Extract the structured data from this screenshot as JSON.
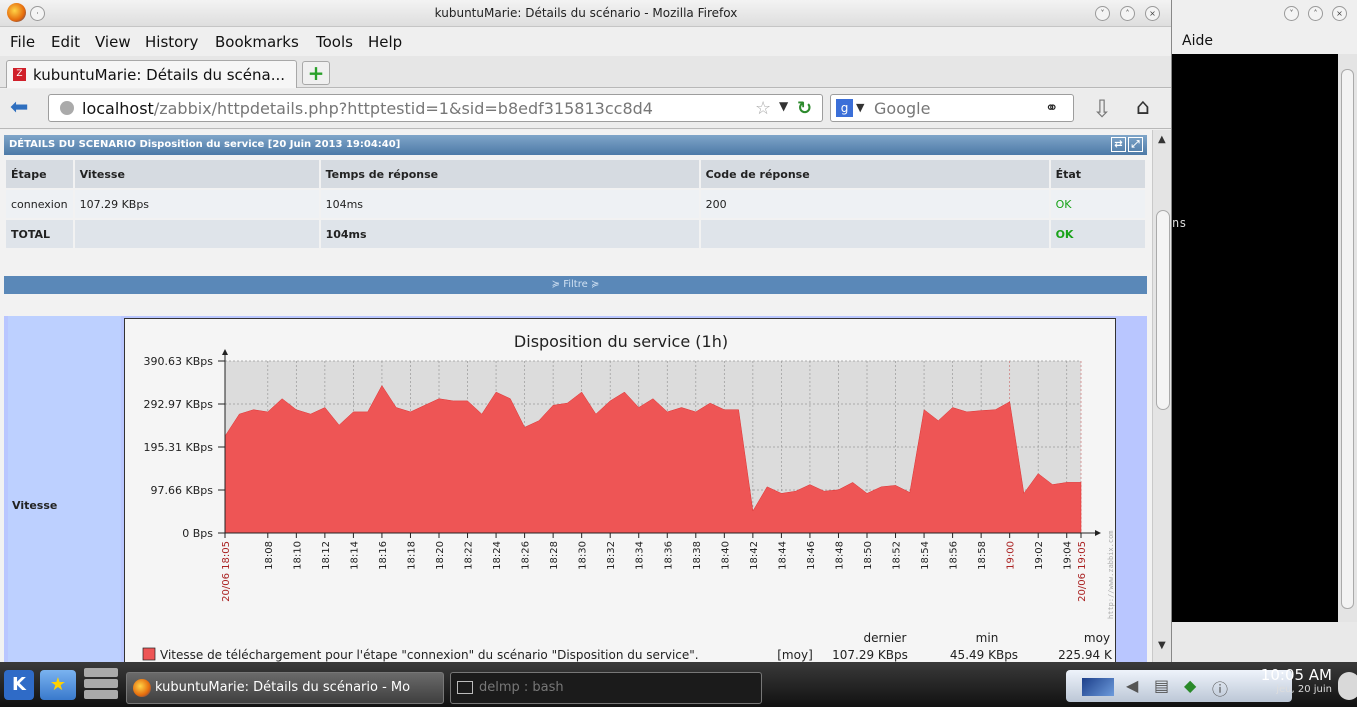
{
  "window": {
    "title": "kubuntuMarie: Détails du scénario - Mozilla Firefox"
  },
  "menu": [
    "File",
    "Edit",
    "View",
    "History",
    "Bookmarks",
    "Tools",
    "Help"
  ],
  "tab": {
    "label": "kubuntuMarie: Détails du scéna...",
    "new_tab": "+"
  },
  "nav": {
    "url_host": "localhost",
    "url_path": "/zabbix/httpdetails.php?httptestid=1&sid=b8edf315813cc8d4",
    "search_engine": "Google"
  },
  "scenario": {
    "header": "DÉTAILS DU SCENARIO Disposition du service [20 Juin 2013 19:04:40]",
    "columns": [
      "Étape",
      "Vitesse",
      "Temps de réponse",
      "Code de réponse",
      "État"
    ],
    "rows": [
      [
        "connexion",
        "107.29 KBps",
        "104ms",
        "200",
        "OK"
      ],
      [
        "TOTAL",
        "",
        "104ms",
        "",
        "OK"
      ]
    ],
    "filter_label": "≽ Filtre ≽"
  },
  "graph_section": {
    "label": "Vitesse"
  },
  "chart_data": {
    "type": "area",
    "title": "Disposition du service (1h)",
    "xlabel": "",
    "ylabel": "",
    "y_ticks": [
      "0 Bps",
      "97.66 KBps",
      "195.31 KBps",
      "292.97 KBps",
      "390.63 KBps"
    ],
    "ylim_kbps": [
      0,
      390.63
    ],
    "x_ticks": [
      "20/06 18:05",
      "18:08",
      "18:10",
      "18:12",
      "18:14",
      "18:16",
      "18:18",
      "18:20",
      "18:22",
      "18:24",
      "18:26",
      "18:28",
      "18:30",
      "18:32",
      "18:34",
      "18:36",
      "18:38",
      "18:40",
      "18:42",
      "18:44",
      "18:46",
      "18:48",
      "18:50",
      "18:52",
      "18:54",
      "18:56",
      "18:58",
      "19:00",
      "19:02",
      "19:04",
      "20/06 19:05"
    ],
    "red_ticks": [
      "20/06 18:05",
      "19:00",
      "20/06 19:05"
    ],
    "series": [
      {
        "name": "Vitesse de téléchargement pour l'étape \"connexion\" du scénario \"Disposition du service\".",
        "color": "#ee5555",
        "x_minutes": [
          0,
          1,
          2,
          3,
          4,
          5,
          6,
          7,
          8,
          9,
          10,
          11,
          12,
          13,
          14,
          15,
          16,
          17,
          18,
          19,
          20,
          21,
          22,
          23,
          24,
          25,
          26,
          27,
          28,
          29,
          30,
          31,
          32,
          33,
          34,
          35,
          36,
          37,
          38,
          39,
          40,
          41,
          42,
          43,
          44,
          45,
          46,
          47,
          48,
          49,
          50,
          51,
          52,
          53,
          54,
          55,
          56,
          57,
          58,
          59,
          60
        ],
        "values_kbps": [
          220,
          270,
          280,
          275,
          305,
          280,
          270,
          285,
          245,
          275,
          275,
          335,
          285,
          275,
          290,
          305,
          300,
          300,
          270,
          320,
          305,
          240,
          255,
          290,
          295,
          320,
          270,
          300,
          320,
          285,
          305,
          275,
          285,
          275,
          295,
          280,
          280,
          50,
          105,
          90,
          95,
          110,
          95,
          98,
          115,
          90,
          105,
          108,
          92,
          280,
          255,
          285,
          275,
          278,
          280,
          298,
          90,
          135,
          110,
          115,
          115
        ]
      }
    ],
    "legend": {
      "swatch_color": "#ee5555",
      "text": "Vitesse de téléchargement pour l'étape \"connexion\" du scénario \"Disposition du service\".",
      "agg": "[moy]",
      "headers": [
        "dernier",
        "min",
        "moy"
      ],
      "values": [
        "107.29 KBps",
        "45.49 KBps",
        "225.94 K"
      ]
    },
    "watermark": "http://www.zabbix.com"
  },
  "konsole": {
    "menu": "Aide",
    "text": "ns"
  },
  "taskbar": {
    "task1": "kubuntuMarie: Détails du scénario - Mo",
    "task2": "delmp : bash",
    "clock_time": "10:05 AM",
    "clock_date": "jeu, 20 juin"
  }
}
